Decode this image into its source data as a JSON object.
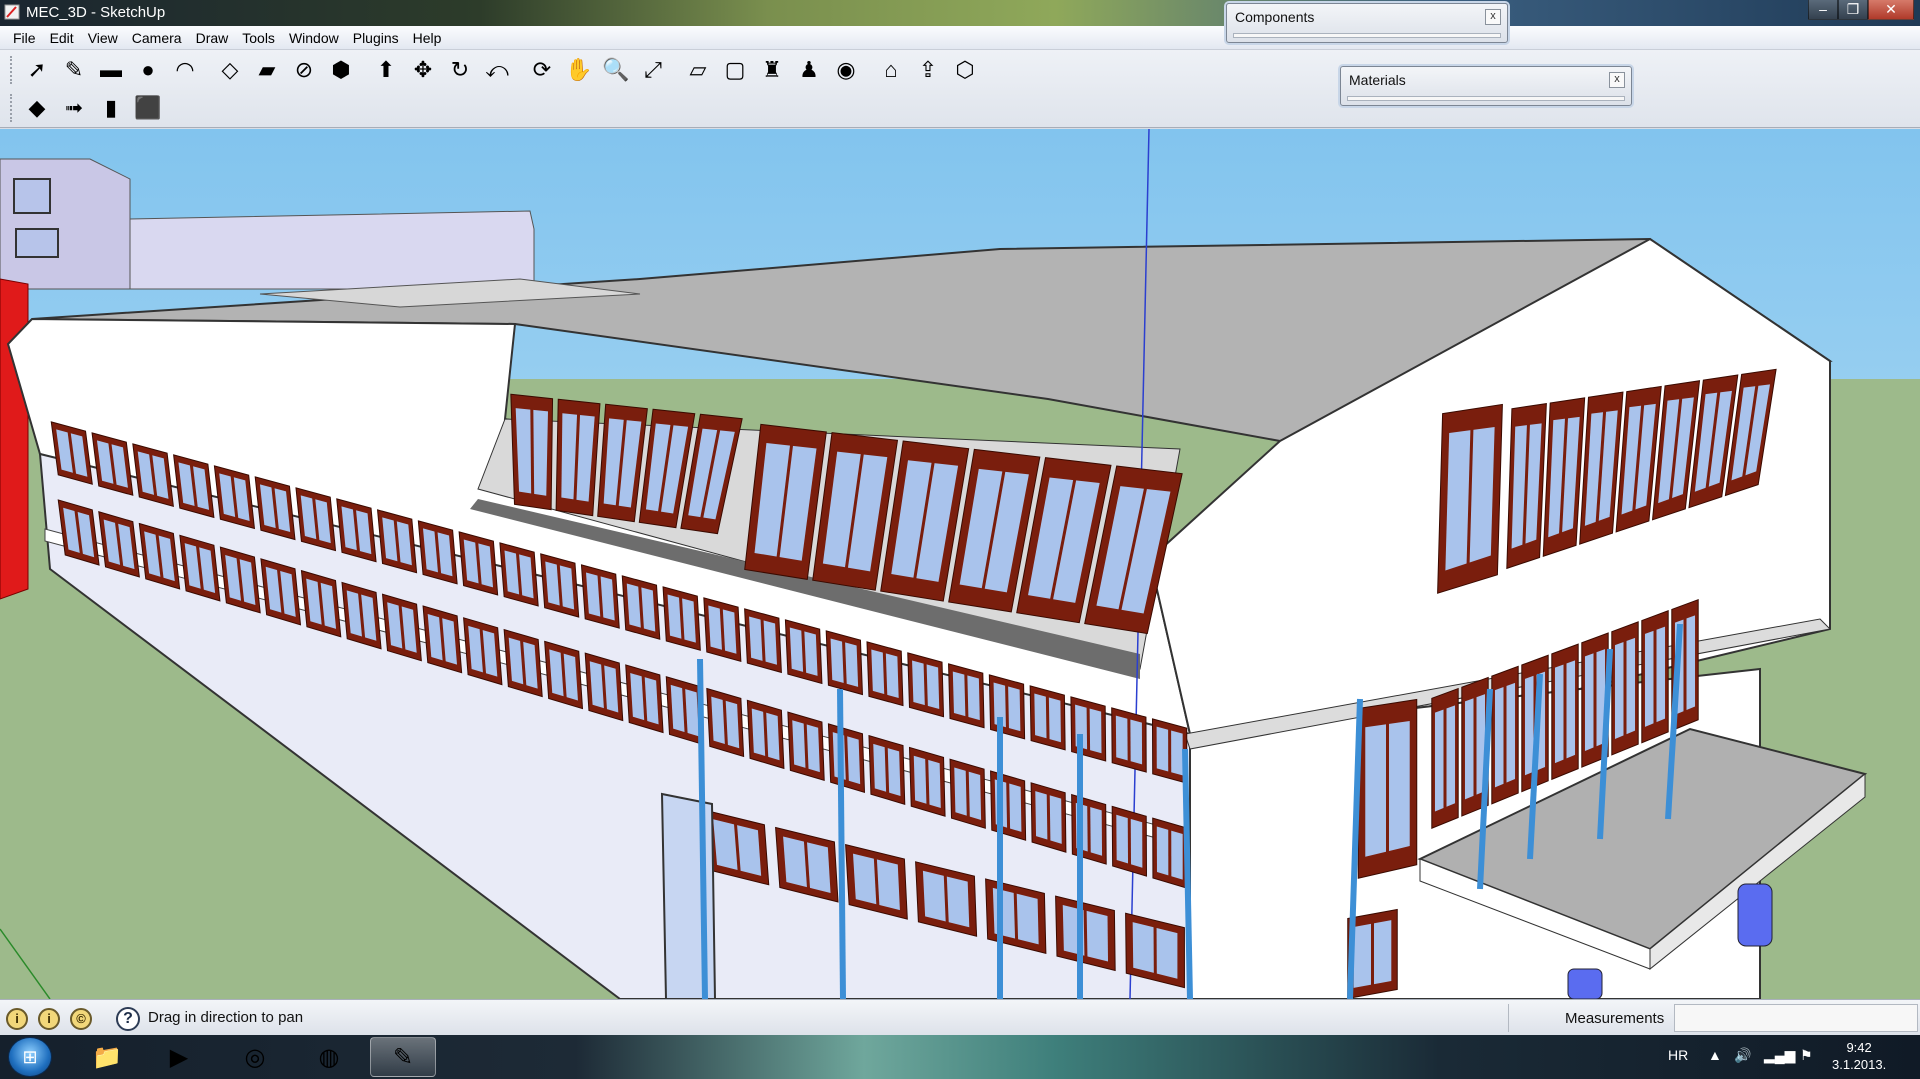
{
  "window": {
    "title": "MEC_3D - SketchUp",
    "controls": [
      "–",
      "❐",
      "✕"
    ]
  },
  "menu": [
    "File",
    "Edit",
    "View",
    "Camera",
    "Draw",
    "Tools",
    "Window",
    "Plugins",
    "Help"
  ],
  "toolbar_row1": [
    {
      "name": "select-tool-icon",
      "glyph": "➚"
    },
    {
      "name": "pencil-line-tool-icon",
      "glyph": "✎"
    },
    {
      "name": "rectangle-tool-icon",
      "glyph": "▬"
    },
    {
      "name": "circle-tool-icon",
      "glyph": "●"
    },
    {
      "name": "arc-tool-icon",
      "glyph": "◠"
    },
    {
      "name": "make-component-icon",
      "glyph": "◇"
    },
    {
      "name": "eraser-tool-icon",
      "glyph": "▰"
    },
    {
      "name": "tape-measure-tool-icon",
      "glyph": "⊘"
    },
    {
      "name": "paint-bucket-tool-icon",
      "glyph": "⬢"
    },
    {
      "name": "push-pull-tool-icon",
      "glyph": "⬆"
    },
    {
      "name": "move-tool-icon",
      "glyph": "✥"
    },
    {
      "name": "rotate-tool-icon",
      "glyph": "↻"
    },
    {
      "name": "offset-tool-icon",
      "glyph": "⤺"
    },
    {
      "name": "orbit-tool-icon",
      "glyph": "⟳"
    },
    {
      "name": "pan-tool-icon",
      "glyph": "✋"
    },
    {
      "name": "zoom-tool-icon",
      "glyph": "🔍"
    },
    {
      "name": "zoom-extents-icon",
      "glyph": "⤢"
    },
    {
      "name": "previous-view-icon",
      "glyph": "▱"
    },
    {
      "name": "next-view-icon",
      "glyph": "▢"
    },
    {
      "name": "position-camera-icon",
      "glyph": "♜"
    },
    {
      "name": "walk-tool-icon",
      "glyph": "♟"
    },
    {
      "name": "look-around-icon",
      "glyph": "◉"
    },
    {
      "name": "get-models-icon",
      "glyph": "⌂"
    },
    {
      "name": "share-model-icon",
      "glyph": "⇪"
    },
    {
      "name": "share-component-icon",
      "glyph": "⬡"
    }
  ],
  "toolbar_row2": [
    {
      "name": "google-earth-icon",
      "glyph": "◆"
    },
    {
      "name": "add-location-icon",
      "glyph": "➟"
    },
    {
      "name": "toggle-terrain-icon",
      "glyph": "▮"
    },
    {
      "name": "photo-textures-icon",
      "glyph": "⬛"
    }
  ],
  "dialogs": {
    "components": {
      "title": "Components",
      "close": "x"
    },
    "materials": {
      "title": "Materials",
      "close": "x"
    }
  },
  "status": {
    "hint": "Drag in direction to pan",
    "help_glyph": "?",
    "icons": [
      "i",
      "i",
      "©"
    ],
    "measurements_label": "Measurements",
    "measurements_value": ""
  },
  "taskbar": {
    "start_glyph": "⊞",
    "apps": [
      {
        "name": "file-explorer-icon",
        "glyph": "📁"
      },
      {
        "name": "media-player-icon",
        "glyph": "▶"
      },
      {
        "name": "chrome-icon",
        "glyph": "◎"
      },
      {
        "name": "firefox-icon",
        "glyph": "◍"
      },
      {
        "name": "sketchup-icon",
        "glyph": "✎"
      }
    ],
    "language": "HR",
    "tray_glyphs": [
      "▲",
      "🔊",
      "▂▄▆",
      "⚑"
    ],
    "time": "9:42",
    "date": "3.1.2013."
  },
  "colors": {
    "sky": "#9fd3f2",
    "ground": "#9db98a",
    "wall": "#ffffff",
    "roof": "#b3b3b3",
    "window_frame": "#7a1e0d",
    "glass": "#a9c3ec",
    "column": "#3d8fd6",
    "accent_red": "#dd1e1e"
  }
}
